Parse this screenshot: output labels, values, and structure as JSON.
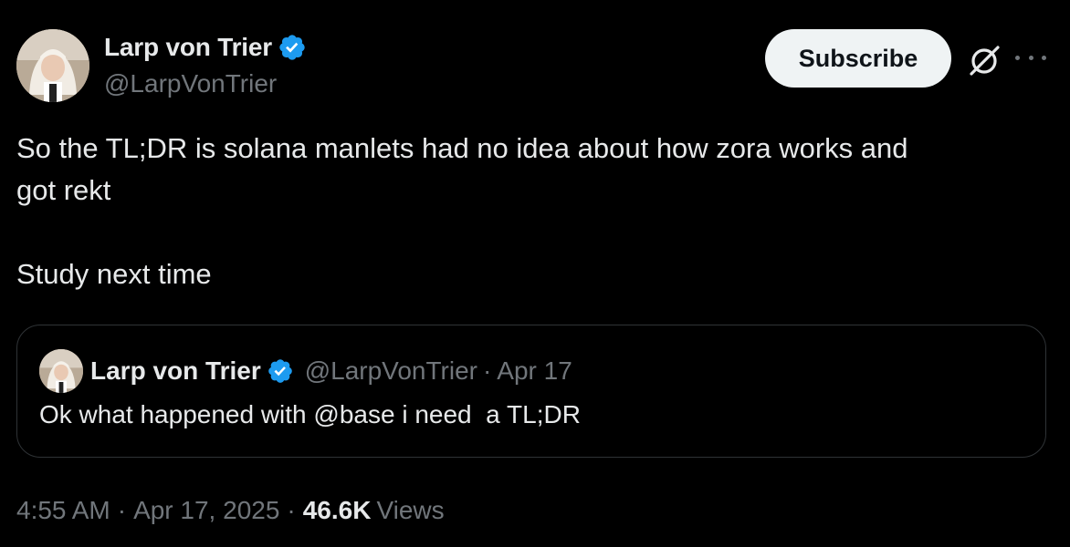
{
  "author": {
    "display_name": "Larp von Trier",
    "handle": "@LarpVonTrier",
    "verified": true
  },
  "actions": {
    "subscribe_label": "Subscribe"
  },
  "tweet": {
    "text": "So the TL;DR is solana manlets had no idea about how zora works and\ngot rekt\n\nStudy next time"
  },
  "quoted_tweet": {
    "display_name": "Larp von Trier",
    "handle": "@LarpVonTrier",
    "separator": "·",
    "date": "Apr 17",
    "text": "Ok what happened with @base i need  a TL;DR"
  },
  "meta": {
    "time": "4:55 AM",
    "separator": "·",
    "date": "Apr 17, 2025",
    "separator2": "·",
    "views_count": "46.6K",
    "views_label": "Views"
  },
  "colors": {
    "background": "#000000",
    "primary_text": "#e7e9ea",
    "secondary_text": "#71767b",
    "verified_blue": "#1d9bf0",
    "border": "#2f3336",
    "button_bg": "#eff3f4"
  },
  "icons": {
    "verified": "verified-badge-icon",
    "grok": "grok-icon",
    "more": "more-icon"
  }
}
